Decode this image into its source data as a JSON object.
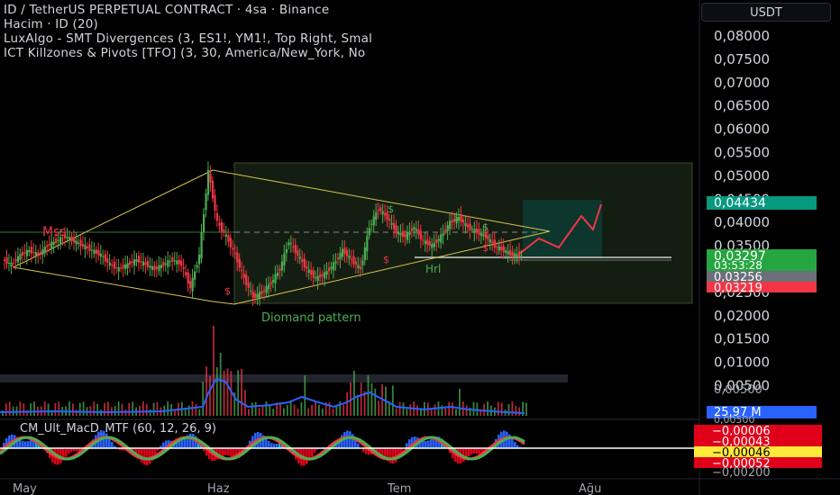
{
  "header": {
    "title": "ID / TetherUS PERPETUAL CONTRACT · 4sa · Binance",
    "volume": "Hacim · ID (20)",
    "indicator1": "LuxAlgo - SMT Divergences (3, ES1!, YM1!, Top Right, Smal",
    "indicator2": "ICT Killzones & Pivots [TFO] (3, 30, America/New_York, No"
  },
  "currency_button": "USDT",
  "oscillator_label": "CM_Ult_MacD_MTF (60, 12, 26, 9)",
  "annotations": {
    "mss": "Mss",
    "diamond": "Diomand pattern",
    "hrl": "Hrl",
    "dollar": "$"
  },
  "price_scale": [
    "0,08000",
    "0,07500",
    "0,07000",
    "0,06500",
    "0,06000",
    "0,05500",
    "0,05000",
    "0,04500",
    "0,04000",
    "0,03500",
    "0,03000",
    "0,02500",
    "0,02000",
    "0,01500",
    "0,01000",
    "0,00500"
  ],
  "price_tags": {
    "target": "0,04434",
    "last": "0,03297",
    "countdown": "03:53:28",
    "level1": "0,03256",
    "level2": "0,03219",
    "volume": "25,97 M",
    "vol_top": "0,00500"
  },
  "osc_scale": {
    "v1": "−0,00006",
    "v2": "−0,00043",
    "v3": "−0,00046",
    "v4": "−0,00052",
    "v5": "−0,00200"
  },
  "time_axis": [
    "May",
    "Haz",
    "Tem",
    "Ağu"
  ],
  "colors": {
    "background": "#000000",
    "pattern_lines": "#d8c64a",
    "zone_fill": "#1a2416",
    "target_box": "#0e3b32",
    "projection": "#f23645",
    "candle_up": "#4caf50",
    "candle_down": "#f23645",
    "volume_ma": "#2962ff",
    "tag_green": "#26a641",
    "tag_red": "#f23645",
    "tag_teal": "#089981"
  },
  "chart_data": {
    "type": "candlestick",
    "symbol": "ID/USDT",
    "interval": "4sa",
    "x": [
      "May",
      "Haz",
      "Tem",
      "Ağu"
    ],
    "ylim": [
      0.0,
      0.085
    ],
    "key_levels": {
      "last": 0.03297,
      "target": 0.04434,
      "level1": 0.03256,
      "level2": 0.03219
    },
    "series": [
      {
        "values": [
          0.032,
          0.031,
          0.033,
          0.034,
          0.033,
          0.035,
          0.036,
          0.037,
          0.036,
          0.035,
          0.034,
          0.033,
          0.031,
          0.03,
          0.031,
          0.032,
          0.031,
          0.03,
          0.031,
          0.032,
          0.031,
          0.026,
          0.033,
          0.051,
          0.04,
          0.037,
          0.033,
          0.028,
          0.024,
          0.025,
          0.027,
          0.03,
          0.036,
          0.033,
          0.03,
          0.028,
          0.029,
          0.031,
          0.034,
          0.032,
          0.03,
          0.039,
          0.043,
          0.041,
          0.038,
          0.037,
          0.039,
          0.036,
          0.035,
          0.037,
          0.04,
          0.041,
          0.039,
          0.038,
          0.037,
          0.035,
          0.034,
          0.033,
          0.033
        ]
      }
    ]
  }
}
